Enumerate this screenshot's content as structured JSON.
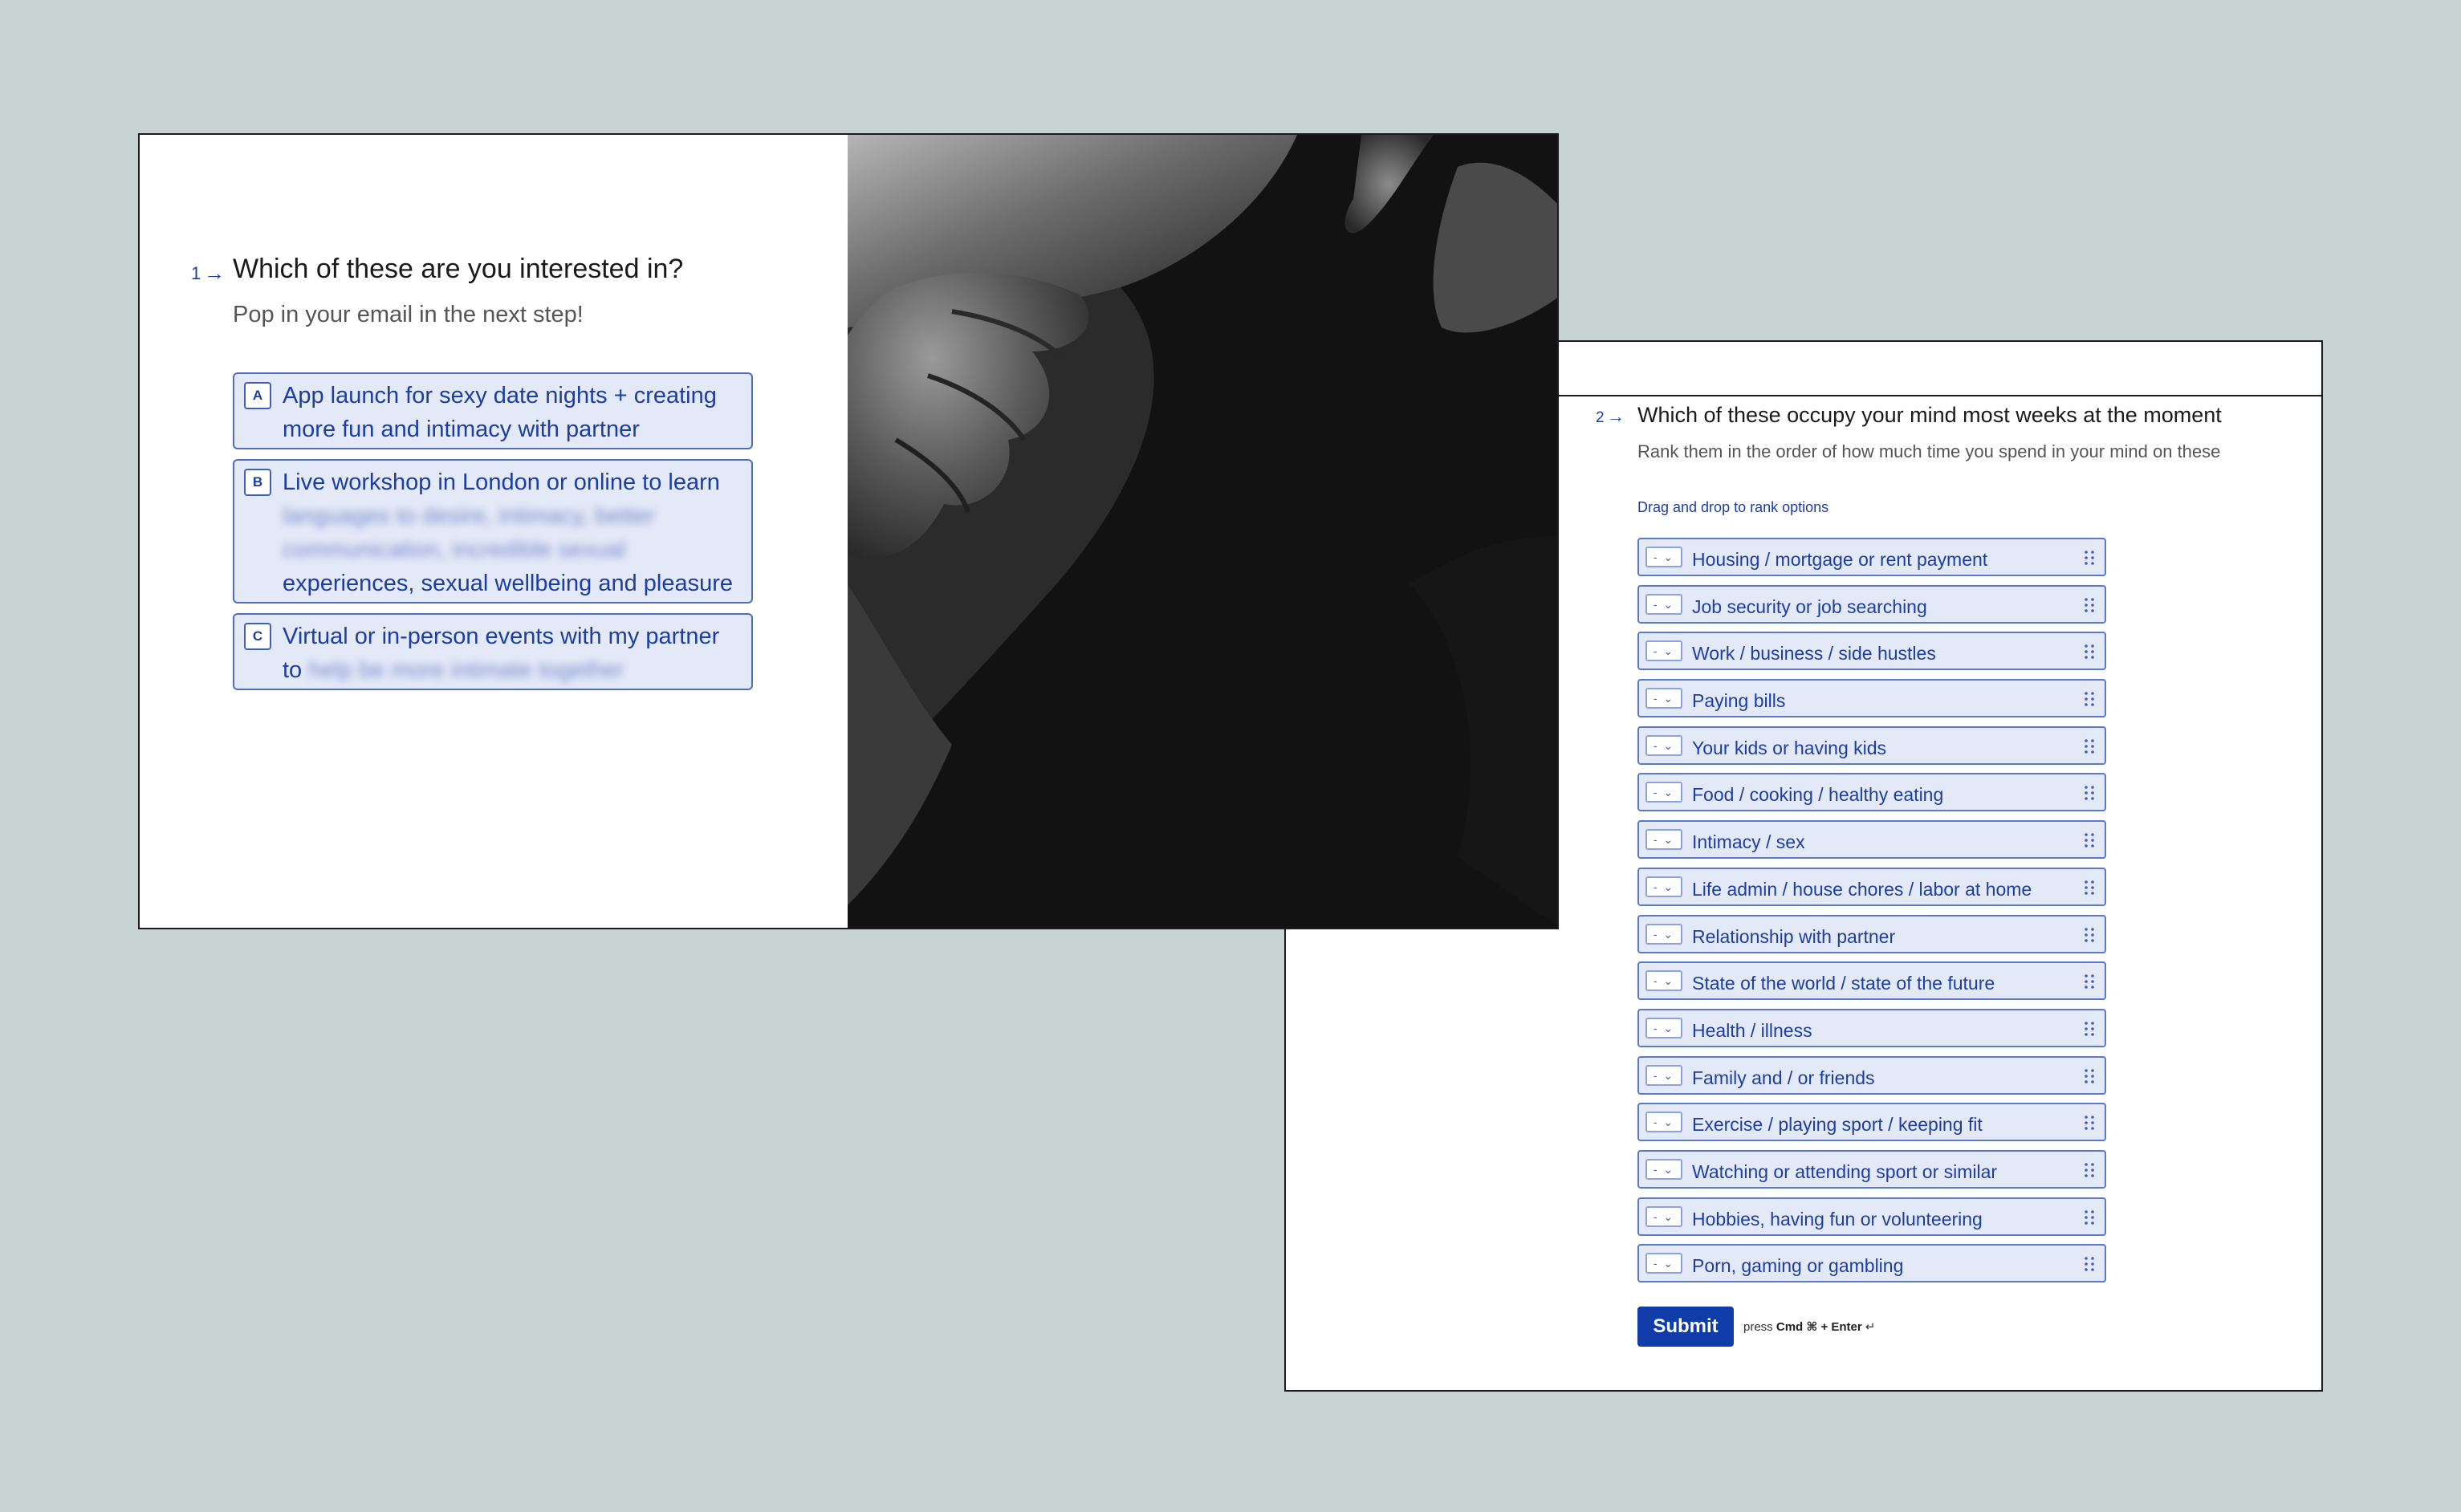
{
  "question1": {
    "number": "1",
    "title": "Which of these are you interested in?",
    "subtitle": "Pop in your email in the next step!",
    "choices": [
      {
        "key": "A",
        "line1": "App launch for sexy date nights + creating",
        "line2": "more fun and intimacy with partner"
      },
      {
        "key": "B",
        "line1": "Live workshop in London or online to learn",
        "blurred1": "languages to desire, intimacy, better",
        "blurred2": "communication, incredible sexual",
        "line4": "experiences, sexual wellbeing and pleasure"
      },
      {
        "key": "C",
        "line1": "Virtual or in-person events with my partner",
        "line2": "to",
        "blurred": "help be more intimate together"
      }
    ]
  },
  "question2": {
    "number": "2",
    "title": "Which of these occupy your mind most weeks at the moment",
    "subtitle": "Rank them in the order of how much time you spend in your mind on these",
    "hint": "Drag and drop to rank options",
    "select_placeholder": "- ⌄",
    "options": [
      "Housing / mortgage or rent payment",
      "Job security or job searching",
      "Work / business / side hustles",
      "Paying bills",
      "Your kids or having kids",
      "Food / cooking / healthy eating",
      "Intimacy / sex",
      "Life admin / house chores / labor at home",
      "Relationship with partner",
      "State of the world / state of the future",
      "Health / illness",
      "Family and / or friends",
      "Exercise / playing sport / keeping fit",
      "Watching or attending sport or similar",
      "Hobbies, having fun or volunteering",
      "Porn, gaming or gambling"
    ],
    "submit_label": "Submit",
    "submit_hint_prefix": "press",
    "submit_hint_keys": "Cmd ⌘ + Enter",
    "submit_hint_suffix": "↵"
  },
  "colors": {
    "accent": "#1c3ea3",
    "button": "#0f3ca8",
    "background": "#c6d3d2",
    "choice_fill": "#e4e9f8"
  },
  "icons": {
    "arrow": "arrow-right-icon",
    "drag": "drag-handle-icon",
    "dropdown": "chevron-down-icon"
  }
}
